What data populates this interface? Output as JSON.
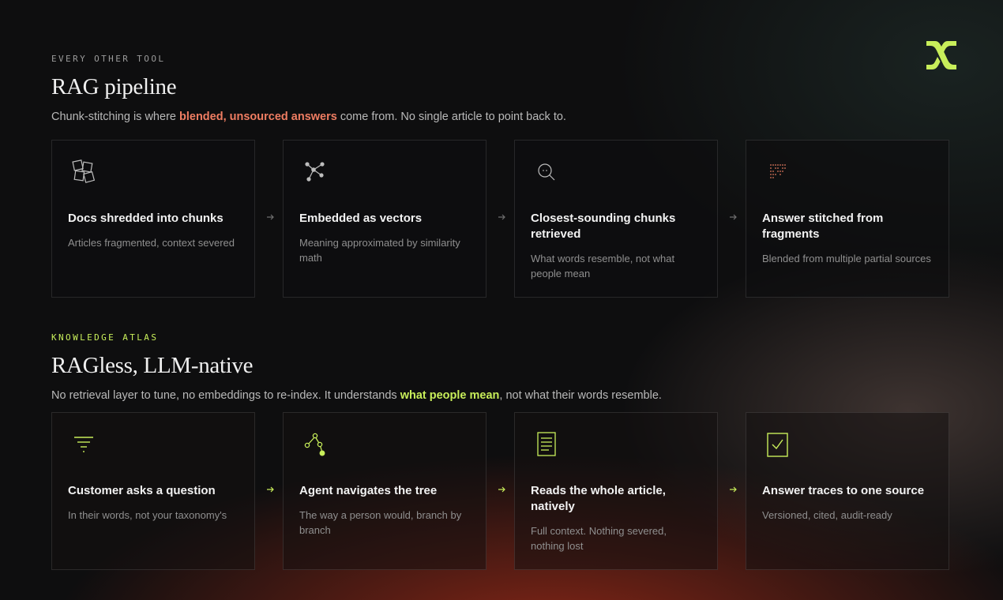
{
  "brand": {
    "logo_icon": "logo-crossed-arrows",
    "accent": "#c8ee5a"
  },
  "sections": [
    {
      "eyebrow": "EVERY OTHER TOOL",
      "title": "RAG pipeline",
      "desc_pre": "Chunk-stitching is where ",
      "desc_highlight": "blended, unsourced answers",
      "desc_post": " come from. No single article to point back to.",
      "highlight_color": "#ef7d62",
      "cards": [
        {
          "icon": "shredded-squares-icon",
          "title": "Docs shredded into chunks",
          "subtitle": "Articles fragmented, context severed"
        },
        {
          "icon": "vector-nodes-icon",
          "title": "Embedded as vectors",
          "subtitle": "Meaning approximated by similarity math"
        },
        {
          "icon": "magnifier-icon",
          "title": "Closest-sounding chunks retrieved",
          "subtitle": "What words resemble, not what people mean"
        },
        {
          "icon": "dot-fragments-icon",
          "title": "Answer stitched from fragments",
          "subtitle": "Blended from multiple partial sources"
        }
      ]
    },
    {
      "eyebrow": "KNOWLEDGE ATLAS",
      "title": "RAGless, LLM-native",
      "desc_pre": "No retrieval layer to tune, no embeddings to re-index. It understands ",
      "desc_highlight": "what people mean",
      "desc_post": ", not what their words resemble.",
      "highlight_color": "#c8ee5a",
      "cards": [
        {
          "icon": "funnel-lines-icon",
          "title": "Customer asks a question",
          "subtitle": "In their words, not your taxonomy's"
        },
        {
          "icon": "tree-nodes-icon",
          "title": "Agent navigates the tree",
          "subtitle": "The way a person would, branch by branch"
        },
        {
          "icon": "document-icon",
          "title": "Reads the whole article, natively",
          "subtitle": "Full context. Nothing severed, nothing lost"
        },
        {
          "icon": "checkbox-icon",
          "title": "Answer traces to one source",
          "subtitle": "Versioned, cited, audit-ready"
        }
      ]
    }
  ]
}
